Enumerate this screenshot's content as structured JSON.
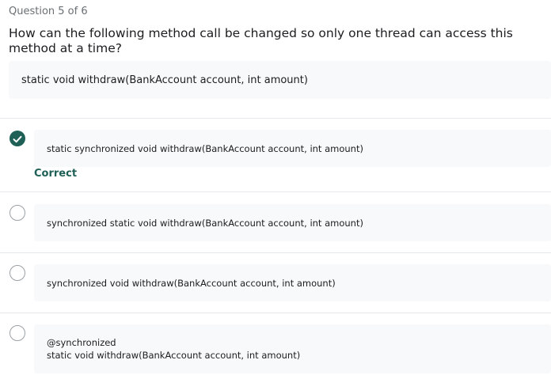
{
  "question": {
    "counter": "Question 5 of 6",
    "prompt": "How can the following method call be changed so only one thread can access this method at a time?",
    "code": "static void withdraw(BankAccount account, int amount)"
  },
  "answers": [
    {
      "lines": [
        "static synchronized void withdraw(BankAccount account, int amount)"
      ],
      "selected": true,
      "feedback": "Correct"
    },
    {
      "lines": [
        "synchronized static void withdraw(BankAccount account, int amount)"
      ],
      "selected": false
    },
    {
      "lines": [
        "synchronized void withdraw(BankAccount account, int amount)"
      ],
      "selected": false
    },
    {
      "lines": [
        "@synchronized",
        "static void withdraw(BankAccount account, int amount)"
      ],
      "selected": false
    }
  ],
  "colors": {
    "correct": "#1e6055",
    "answer_bg": "#f7f9fa",
    "divider": "#e4e8eb"
  },
  "icons": {
    "selected": "checkmark-icon"
  }
}
